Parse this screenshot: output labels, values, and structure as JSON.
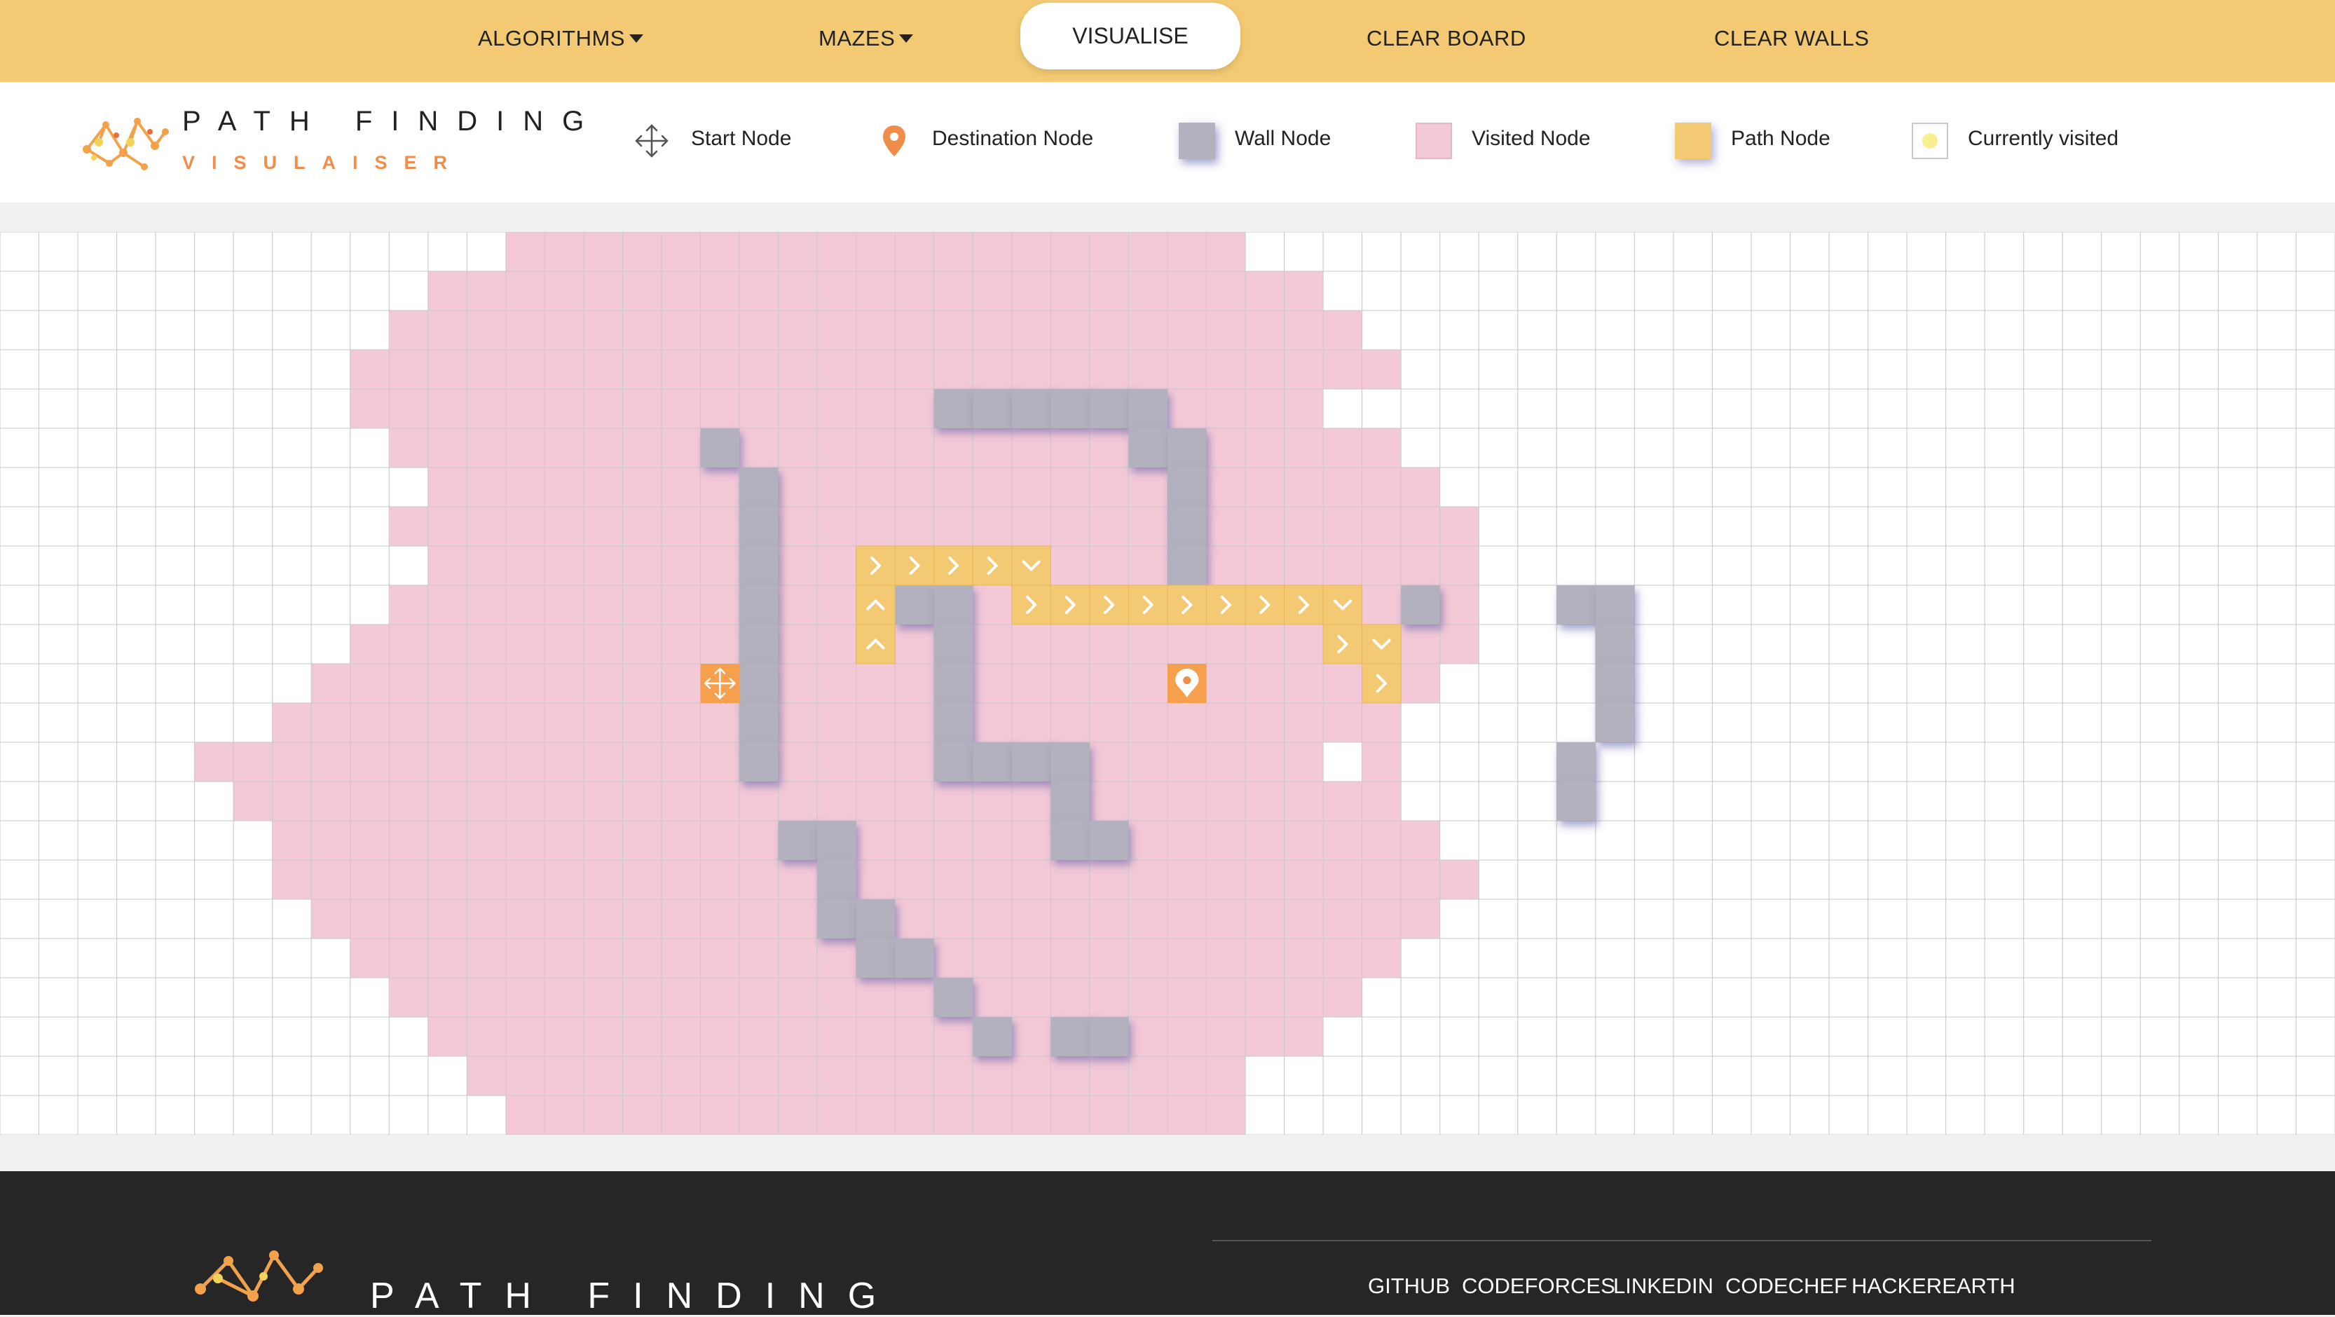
{
  "navbar": {
    "algorithms_label": "ALGORITHMS",
    "mazes_label": "MAZES",
    "visualise_label": "VISUALISE",
    "clear_board_label": "CLEAR BOARD",
    "clear_walls_label": "CLEAR WALLS"
  },
  "logo": {
    "title": "PATH FINDING",
    "subtitle": "VISULAISER"
  },
  "legend": {
    "start": "Start Node",
    "destination": "Destination Node",
    "wall": "Wall Node",
    "visited": "Visited Node",
    "path": "Path Node",
    "current": "Currently visited"
  },
  "colors": {
    "navbar": "#f3ca73",
    "visited": "#f4c9d7",
    "wall": "#b3b1bd",
    "path": "#f3ca73",
    "start": "#f6a04e",
    "destination_pin": "#f08d4a",
    "grid_line": "#c9c9c9",
    "footer": "#262626"
  },
  "grid": {
    "columns": 60,
    "rows": 23,
    "start": [
      18,
      11
    ],
    "destination": [
      30,
      11
    ],
    "walls": [
      [
        18,
        5
      ],
      [
        24,
        4
      ],
      [
        25,
        4
      ],
      [
        26,
        4
      ],
      [
        27,
        4
      ],
      [
        28,
        4
      ],
      [
        29,
        4
      ],
      [
        29,
        5
      ],
      [
        30,
        5
      ],
      [
        30,
        6
      ],
      [
        30,
        7
      ],
      [
        30,
        8
      ],
      [
        19,
        6
      ],
      [
        19,
        7
      ],
      [
        19,
        8
      ],
      [
        19,
        9
      ],
      [
        19,
        10
      ],
      [
        19,
        11
      ],
      [
        19,
        12
      ],
      [
        19,
        13
      ],
      [
        23,
        9
      ],
      [
        24,
        9
      ],
      [
        24,
        10
      ],
      [
        24,
        11
      ],
      [
        24,
        12
      ],
      [
        24,
        13
      ],
      [
        25,
        13
      ],
      [
        26,
        13
      ],
      [
        27,
        13
      ],
      [
        27,
        14
      ],
      [
        27,
        15
      ],
      [
        28,
        15
      ],
      [
        20,
        15
      ],
      [
        21,
        15
      ],
      [
        21,
        16
      ],
      [
        21,
        17
      ],
      [
        22,
        17
      ],
      [
        22,
        18
      ],
      [
        23,
        18
      ],
      [
        24,
        19
      ],
      [
        25,
        20
      ],
      [
        27,
        20
      ],
      [
        28,
        20
      ],
      [
        36,
        9
      ],
      [
        40,
        9
      ],
      [
        41,
        9
      ],
      [
        41,
        10
      ],
      [
        41,
        11
      ],
      [
        41,
        12
      ],
      [
        40,
        13
      ],
      [
        40,
        14
      ]
    ],
    "path": [
      {
        "cell": [
          22,
          8
        ],
        "arrow": "right"
      },
      {
        "cell": [
          23,
          8
        ],
        "arrow": "right"
      },
      {
        "cell": [
          24,
          8
        ],
        "arrow": "right"
      },
      {
        "cell": [
          25,
          8
        ],
        "arrow": "right"
      },
      {
        "cell": [
          26,
          8
        ],
        "arrow": "down"
      },
      {
        "cell": [
          22,
          9
        ],
        "arrow": "up"
      },
      {
        "cell": [
          22,
          10
        ],
        "arrow": "up"
      },
      {
        "cell": [
          26,
          9
        ],
        "arrow": "right"
      },
      {
        "cell": [
          27,
          9
        ],
        "arrow": "right"
      },
      {
        "cell": [
          28,
          9
        ],
        "arrow": "right"
      },
      {
        "cell": [
          29,
          9
        ],
        "arrow": "right"
      },
      {
        "cell": [
          30,
          9
        ],
        "arrow": "right"
      },
      {
        "cell": [
          31,
          9
        ],
        "arrow": "right"
      },
      {
        "cell": [
          32,
          9
        ],
        "arrow": "right"
      },
      {
        "cell": [
          33,
          9
        ],
        "arrow": "right"
      },
      {
        "cell": [
          34,
          9
        ],
        "arrow": "down"
      },
      {
        "cell": [
          34,
          10
        ],
        "arrow": "right"
      },
      {
        "cell": [
          35,
          10
        ],
        "arrow": "down"
      },
      {
        "cell": [
          35,
          11
        ],
        "arrow": "right"
      }
    ],
    "visited_rows": [
      [
        13,
        31
      ],
      [
        11,
        33
      ],
      [
        10,
        34
      ],
      [
        9,
        35
      ],
      [
        9,
        33
      ],
      [
        10,
        35
      ],
      [
        11,
        36
      ],
      [
        10,
        37
      ],
      [
        11,
        37
      ],
      [
        10,
        37
      ],
      [
        9,
        37
      ],
      [
        8,
        36
      ],
      [
        7,
        35
      ],
      [
        5,
        35
      ],
      [
        6,
        35
      ],
      [
        7,
        36
      ],
      [
        7,
        37
      ],
      [
        8,
        36
      ],
      [
        9,
        35
      ],
      [
        10,
        34
      ],
      [
        11,
        33
      ],
      [
        12,
        31
      ],
      [
        13,
        31
      ]
    ],
    "visited_exclusions": [
      [
        34,
        4
      ],
      [
        34,
        13
      ]
    ]
  },
  "footer": {
    "logo_title": "PATH FINDING",
    "links": [
      "GITHUB",
      "CODEFORCES",
      "LINKEDIN",
      "CODECHEF",
      "HACKEREARTH"
    ]
  }
}
